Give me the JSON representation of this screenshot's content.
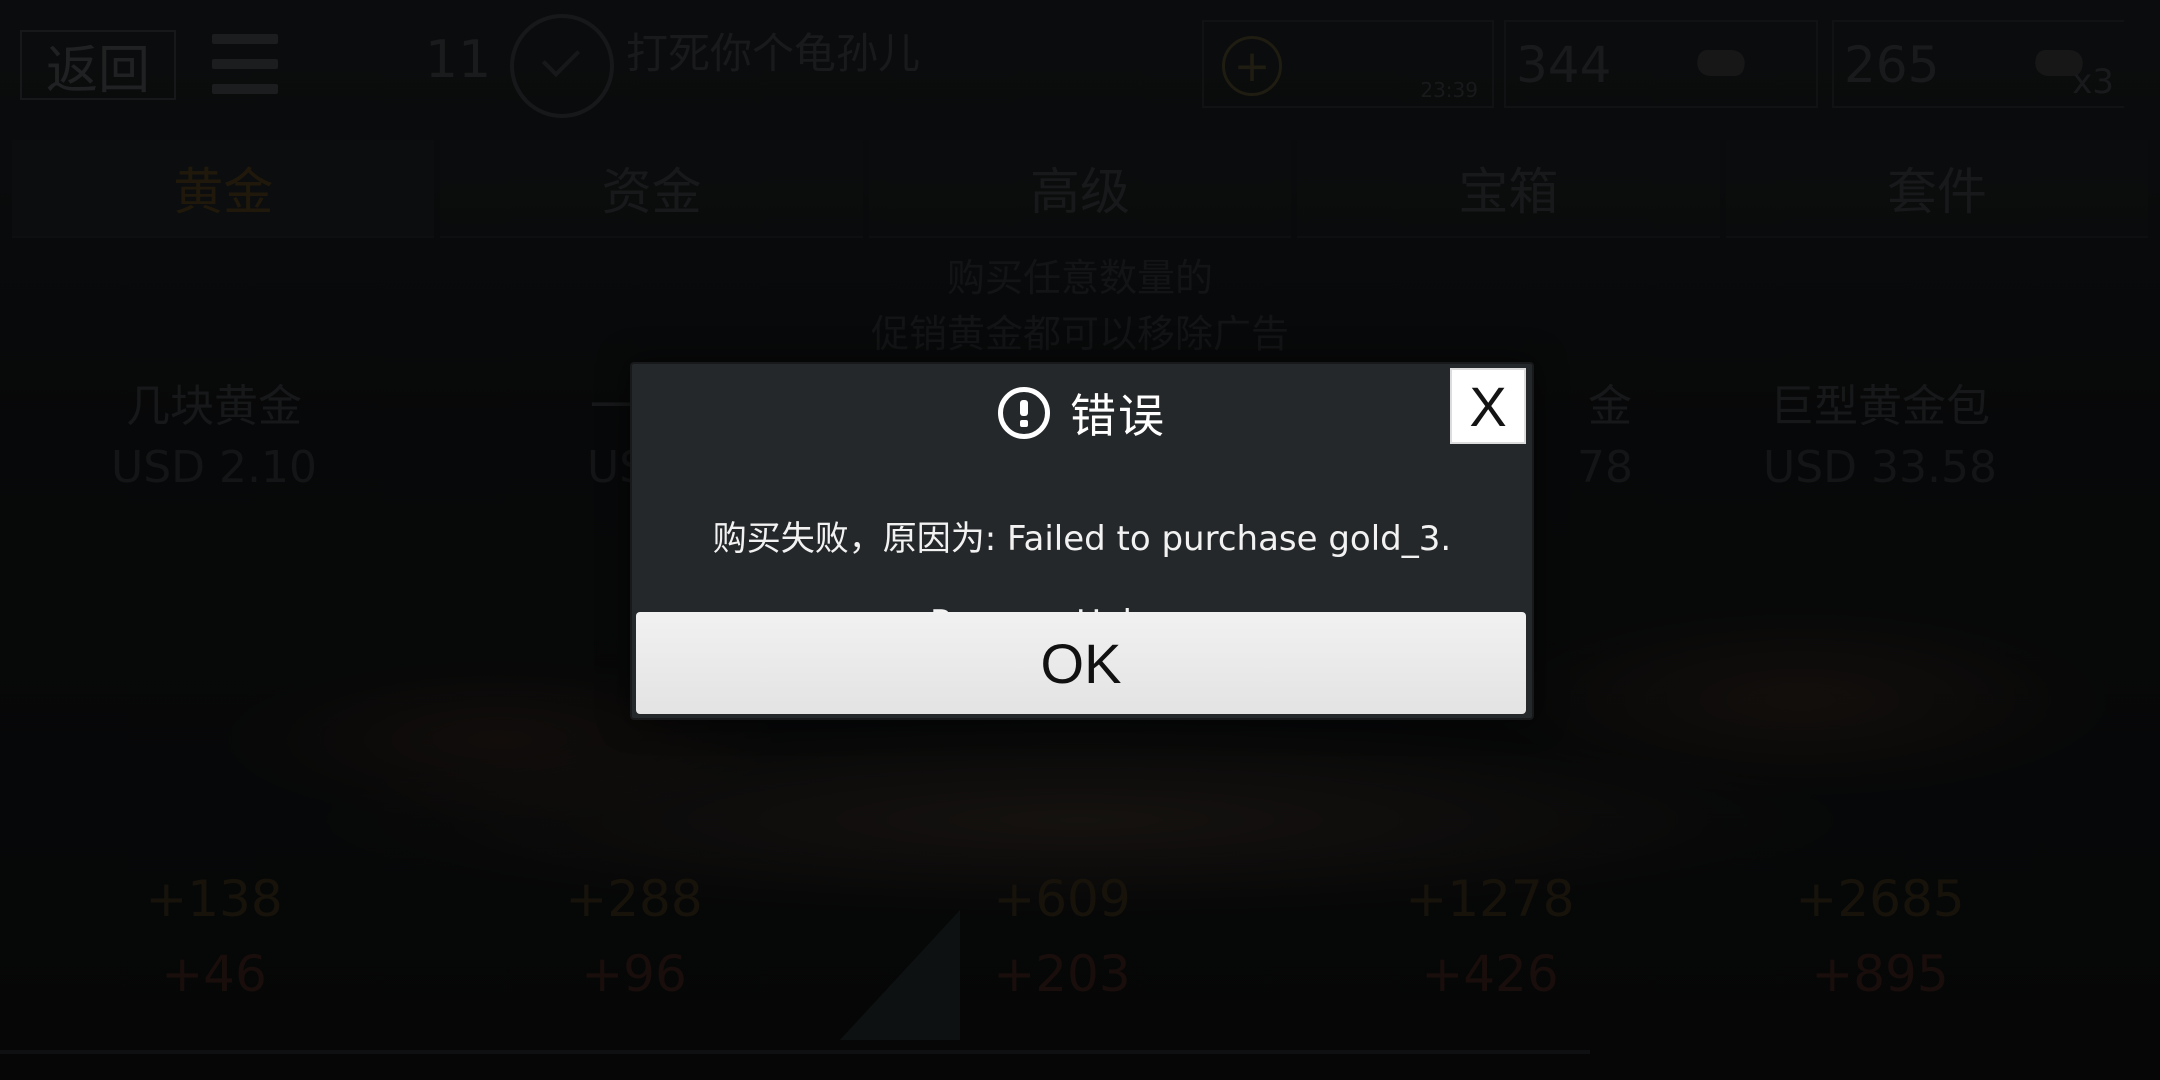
{
  "topbar": {
    "back_label": "返回",
    "level": "11",
    "player_name": "打死你个龟孙儿",
    "timer": "23:39",
    "gold_amount": "344",
    "cash_amount": "265",
    "multiplier": "x3"
  },
  "tabs": [
    {
      "label": "黄金",
      "active": true
    },
    {
      "label": "资金",
      "active": false
    },
    {
      "label": "高级",
      "active": false
    },
    {
      "label": "宝箱",
      "active": false
    },
    {
      "label": "套件",
      "active": false
    }
  ],
  "promo": {
    "line1": "购买任意数量的",
    "line2": "促销黄金都可以移除广告"
  },
  "products": [
    {
      "name": "几块黄金",
      "price": "USD 2.10",
      "amount": "+138",
      "bonus": "+46"
    },
    {
      "name": "一把",
      "price": "USD",
      "amount": "+288",
      "bonus": "+96"
    },
    {
      "name": "",
      "price": "",
      "amount": "+609",
      "bonus": "+203"
    },
    {
      "name": "金",
      "price": "78",
      "amount": "+1278",
      "bonus": "+426"
    },
    {
      "name": "巨型黄金包",
      "price": "USD 33.58",
      "amount": "+2685",
      "bonus": "+895"
    }
  ],
  "dialog": {
    "icon": "alert-circle-icon",
    "title": "错误",
    "message_line1": "购买失败，原因为: Failed to purchase gold_3.",
    "message_line2": "Reason: Unknown",
    "close_label": "X",
    "ok_label": "OK"
  }
}
